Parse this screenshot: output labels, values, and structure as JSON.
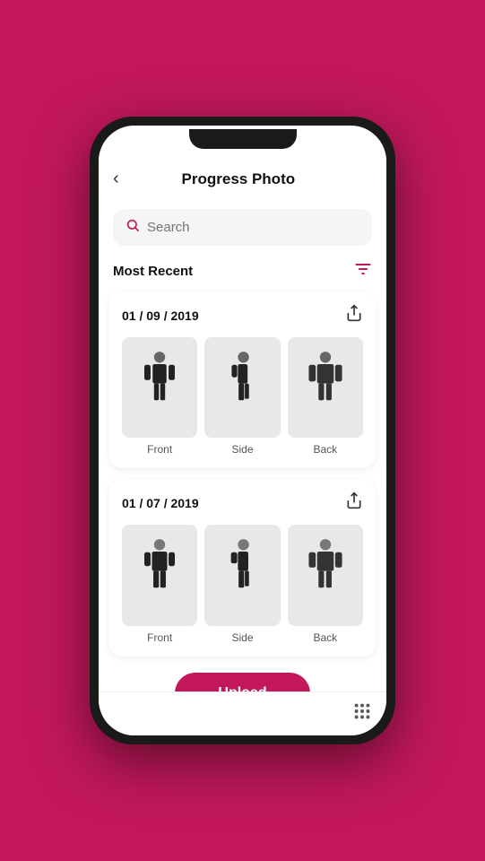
{
  "app": {
    "title": "Progress Photo",
    "back_label": "‹",
    "search_placeholder": "Search",
    "section_title": "Most Recent",
    "upload_label": "Upload"
  },
  "cards": [
    {
      "date": "01 / 09 / 2019",
      "photos": [
        {
          "label": "Front",
          "view": "front"
        },
        {
          "label": "Side",
          "view": "side"
        },
        {
          "label": "Back",
          "view": "back"
        }
      ]
    },
    {
      "date": "01 / 07 / 2019",
      "photos": [
        {
          "label": "Front",
          "view": "front"
        },
        {
          "label": "Side",
          "view": "side"
        },
        {
          "label": "Back",
          "view": "back"
        }
      ]
    }
  ],
  "colors": {
    "accent": "#c2185b",
    "background": "#c2185b"
  }
}
